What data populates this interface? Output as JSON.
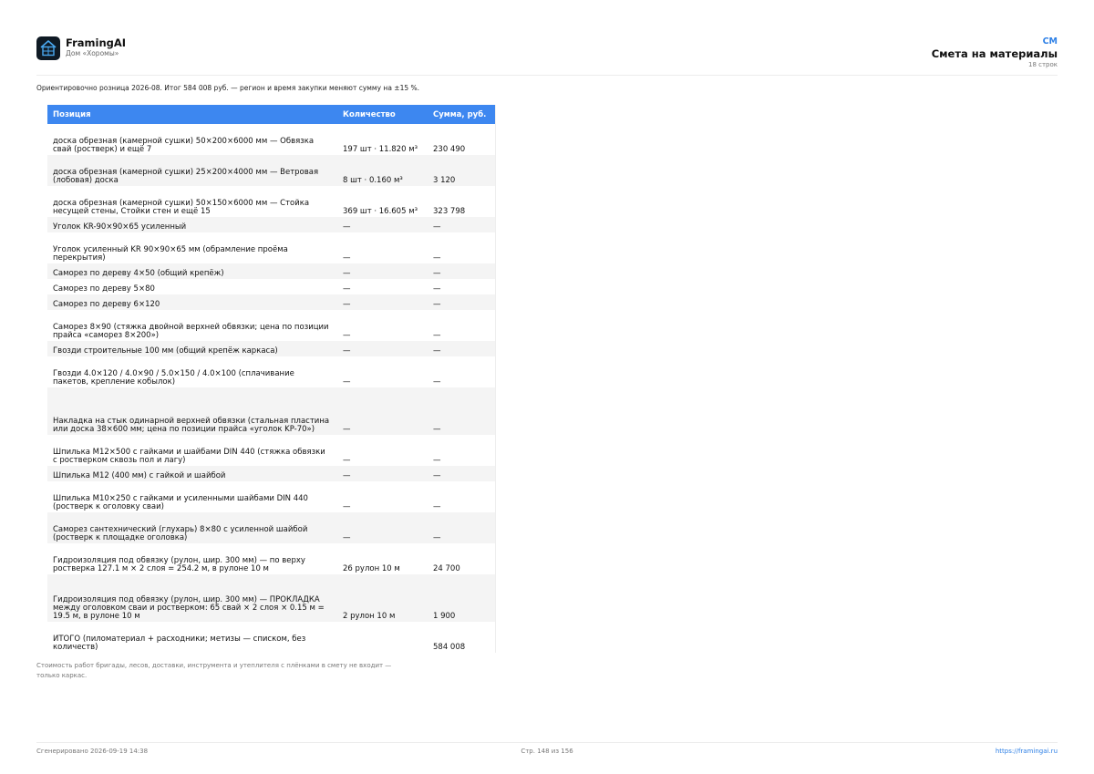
{
  "header": {
    "brand": "FramingAI",
    "project": "Дом «Хоромы»",
    "code": "CM",
    "title": "Смета на материалы",
    "rows_count": "18 строк"
  },
  "note": "Ориентировочно розница 2026-08. Итог 584 008 руб. — регион и время закупки меняют сумму на ±15 %.",
  "table": {
    "columns": [
      "Позиция",
      "Количество",
      "Сумма, руб."
    ],
    "rows": [
      {
        "item": "доска обрезная (камерной сушки) 50×200×6000 мм — Обвязка свай (ростверк) и ещё 7",
        "qty": "197 шт · 11.820 м³",
        "sum": "230 490"
      },
      {
        "item": "доска обрезная (камерной сушки) 25×200×4000 мм — Ветровая (лобовая) доска",
        "qty": "8 шт · 0.160 м³",
        "sum": "3 120"
      },
      {
        "item": "доска обрезная (камерной сушки) 50×150×6000 мм — Стойка несущей стены, Стойки стен и ещё 15",
        "qty": "369 шт · 16.605 м³",
        "sum": "323 798"
      },
      {
        "item": "Уголок KR-90×90×65 усиленный",
        "qty": "—",
        "sum": "—"
      },
      {
        "item": "Уголок усиленный KR 90×90×65 мм (обрамление проёма перекрытия)",
        "qty": "—",
        "sum": "—"
      },
      {
        "item": "Саморез по дереву 4×50 (общий крепёж)",
        "qty": "—",
        "sum": "—"
      },
      {
        "item": "Саморез по дереву 5×80",
        "qty": "—",
        "sum": "—"
      },
      {
        "item": "Саморез по дереву 6×120",
        "qty": "—",
        "sum": "—"
      },
      {
        "item": "Саморез 8×90 (стяжка двойной верхней обвязки; цена по позиции прайса «саморез 8×200»)",
        "qty": "—",
        "sum": "—"
      },
      {
        "item": "Гвозди строительные 100 мм (общий крепёж каркаса)",
        "qty": "—",
        "sum": "—"
      },
      {
        "item": "Гвозди 4.0×120 / 4.0×90 / 5.0×150 / 4.0×100 (сплачивание пакетов, крепление кобылок)",
        "qty": "—",
        "sum": "—"
      },
      {
        "item": "Накладка на стык одинарной верхней обвязки (стальная пластина или доска 38×600 мм; цена по позиции прайса «уголок KP-70»)",
        "qty": "—",
        "sum": "—"
      },
      {
        "item": "Шпилька M12×500 с гайками и шайбами DIN 440 (стяжка обвязки с ростверком сквозь пол и лагу)",
        "qty": "—",
        "sum": "—"
      },
      {
        "item": "Шпилька M12 (400 мм) с гайкой и шайбой",
        "qty": "—",
        "sum": "—"
      },
      {
        "item": "Шпилька M10×250 с гайками и усиленными шайбами DIN 440 (ростверк к оголовку сваи)",
        "qty": "—",
        "sum": "—"
      },
      {
        "item": "Саморез сантехнический (глухарь) 8×80 с усиленной шайбой (ростверк к площадке оголовка)",
        "qty": "—",
        "sum": "—"
      },
      {
        "item": "Гидроизоляция под обвязку (рулон, шир. 300 мм) — по верху ростверка 127.1 м × 2 слоя = 254.2 м, в рулоне 10 м",
        "qty": "26 рулон 10 м",
        "sum": "24 700"
      },
      {
        "item": "Гидроизоляция под обвязку (рулон, шир. 300 мм) — ПРОКЛАДКА между оголовком сваи и ростверком: 65 свай × 2 слоя × 0.15 м = 19.5 м, в рулоне 10 м",
        "qty": "2 рулон 10 м",
        "sum": "1 900"
      },
      {
        "item": "ИТОГО (пиломатериал + расходники; метизы — списком, без количеств)",
        "qty": "",
        "sum": "584 008"
      }
    ]
  },
  "disclaimer": "Стоимость работ бригады, лесов, доставки, инструмента и утеплителя с плёнками в смету не входит — только каркас.",
  "footer": {
    "generated": "Сгенерировано 2026-09-19 14:38",
    "page": "Стр. 148 из 156",
    "url": "https://framingai.ru"
  }
}
